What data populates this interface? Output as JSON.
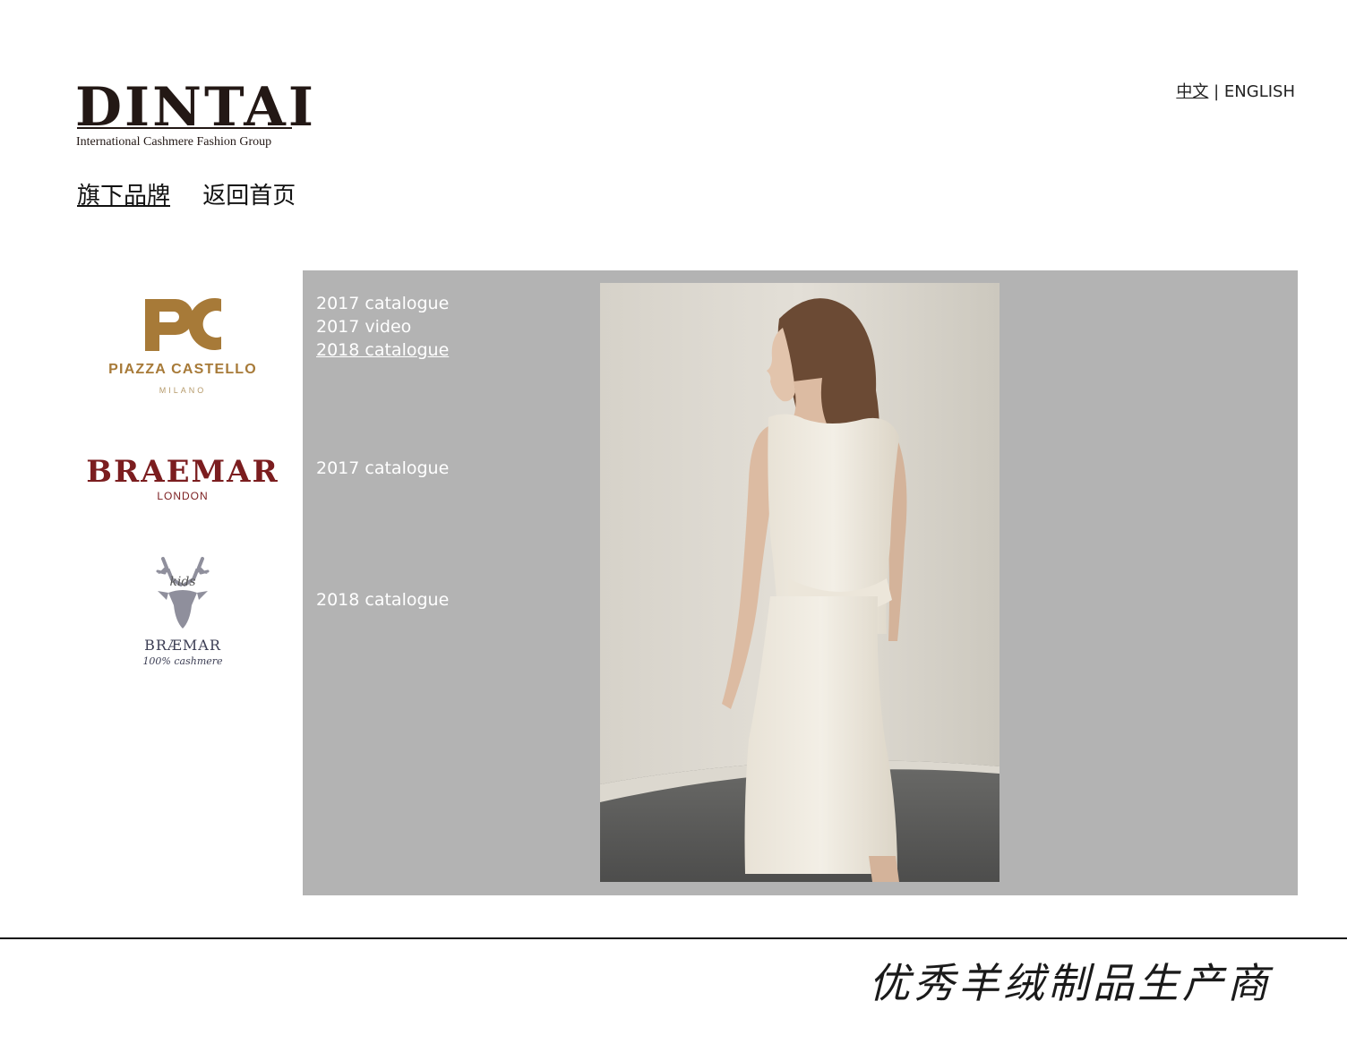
{
  "header": {
    "logo_word": "DINTAI",
    "logo_tagline": "International Cashmere Fashion Group",
    "lang_cn": "中文",
    "lang_sep": "|",
    "lang_en": "ENGLISH"
  },
  "nav": {
    "items": [
      {
        "label": "旗下品牌",
        "active": true
      },
      {
        "label": "返回首页",
        "active": false
      }
    ]
  },
  "brands": [
    {
      "name": "PIAZZA CASTELLO",
      "monogram": "PC",
      "sub": "MILANO",
      "color": "#a77a38",
      "links": [
        {
          "label": "2017 catalogue"
        },
        {
          "label": "2017 video"
        },
        {
          "label": "2018 catalogue",
          "current": true
        }
      ]
    },
    {
      "name": "BRAEMAR",
      "sub": "LONDON",
      "color": "#7b1d1f",
      "links": [
        {
          "label": "2017 catalogue"
        }
      ]
    },
    {
      "name": "BRÆMAR",
      "badge": "kids",
      "sub": "100% cashmere",
      "color": "#8f8f9c",
      "links": [
        {
          "label": "2018 catalogue"
        }
      ]
    }
  ],
  "panel": {
    "background": "#b3b3b3",
    "photo_alt": "model-in-cream-dress-photo"
  },
  "footer": {
    "slogan": "优秀羊绒制品生产商"
  }
}
